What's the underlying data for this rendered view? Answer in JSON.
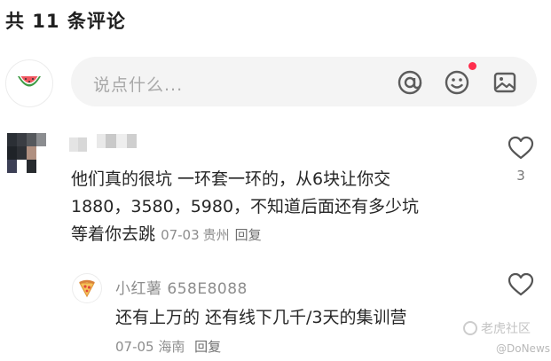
{
  "header": {
    "comment_count_title": "共 11 条评论"
  },
  "composer": {
    "placeholder": "说点什么...",
    "icons": [
      "at-icon",
      "emoji-icon",
      "image-icon"
    ],
    "notification_dot_color": "#ff2e4d"
  },
  "comments": [
    {
      "text_lines": [
        "他们真的很坑 一环套一环的，从6块让你交",
        "1880，3580，5980，不知道后面还有多少坑",
        "等着你去跳"
      ],
      "date": "07-03",
      "location": "贵州",
      "reply_label": "回复",
      "likes": "3",
      "replies": [
        {
          "author": "小红薯 658E8088",
          "text": "还有上万的 还有线下几千/3天的集训营",
          "date": "07-05",
          "location": "海南",
          "reply_label": "回复"
        }
      ]
    }
  ],
  "watermark": {
    "text": "老虎社区",
    "sub": "@DoNews"
  }
}
